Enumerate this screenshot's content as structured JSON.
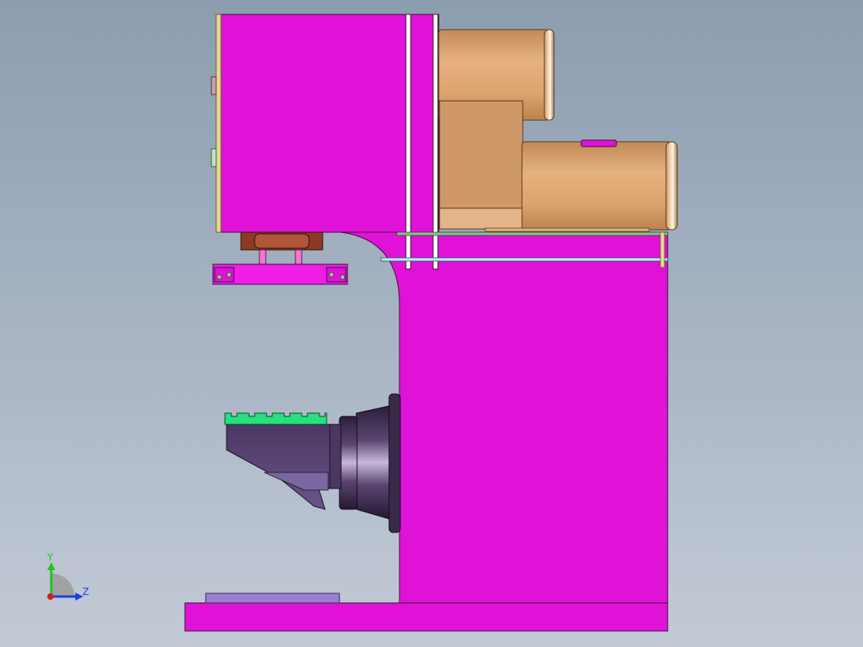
{
  "view": {
    "triad": {
      "y_label": "Y",
      "z_label": "Z"
    },
    "colors": {
      "frame": "#e012d8",
      "motor": "#dca36e",
      "motor_dark": "#a9764a",
      "gearbox": "#c9925f",
      "worktable": "#5e4a78",
      "chuck": "#3f2e4e",
      "t_slot": "#27e07e",
      "base_plate": "#9b7fd0",
      "cylinder": "#7f3a20",
      "panel": "#e7d98f",
      "triad_y": "#21c321",
      "triad_z": "#1f3fe0",
      "triad_x": "#d81818"
    }
  }
}
